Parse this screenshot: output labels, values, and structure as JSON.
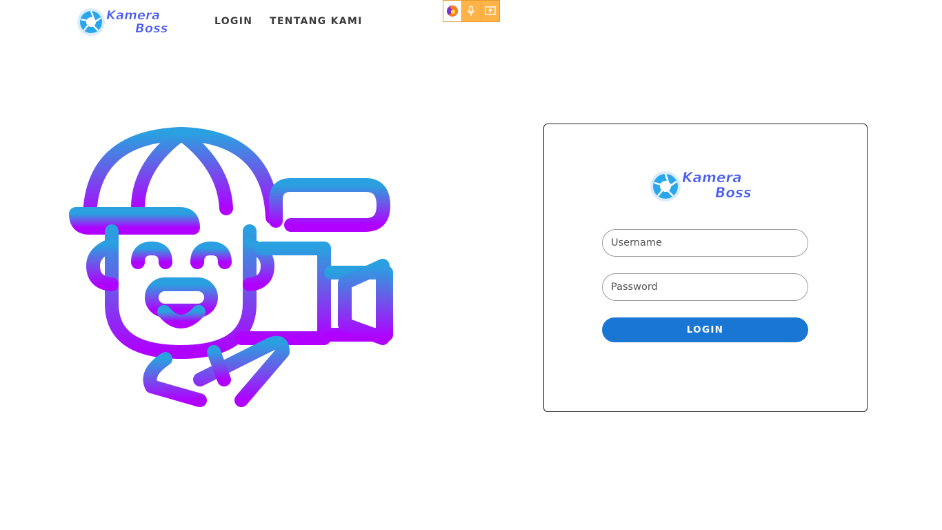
{
  "brand": {
    "logo_line1": "Kamera",
    "logo_line2": "Boss",
    "text_color": "#4a5cf0",
    "lens_color": "#2aa6ea"
  },
  "nav": {
    "items": [
      {
        "label": "LOGIN"
      },
      {
        "label": "TENTANG KAMI"
      }
    ]
  },
  "share_toolbar": {
    "icons": [
      "firefox-icon",
      "microphone-icon",
      "screen-share-icon"
    ]
  },
  "login_form": {
    "username_placeholder": "Username",
    "password_placeholder": "Password",
    "submit_label": "LOGIN",
    "button_color": "#1976d2"
  },
  "illustration": {
    "subject": "cameraman-pig-icon",
    "gradient_top": "#2aa0e0",
    "gradient_bottom": "#b000ff"
  }
}
